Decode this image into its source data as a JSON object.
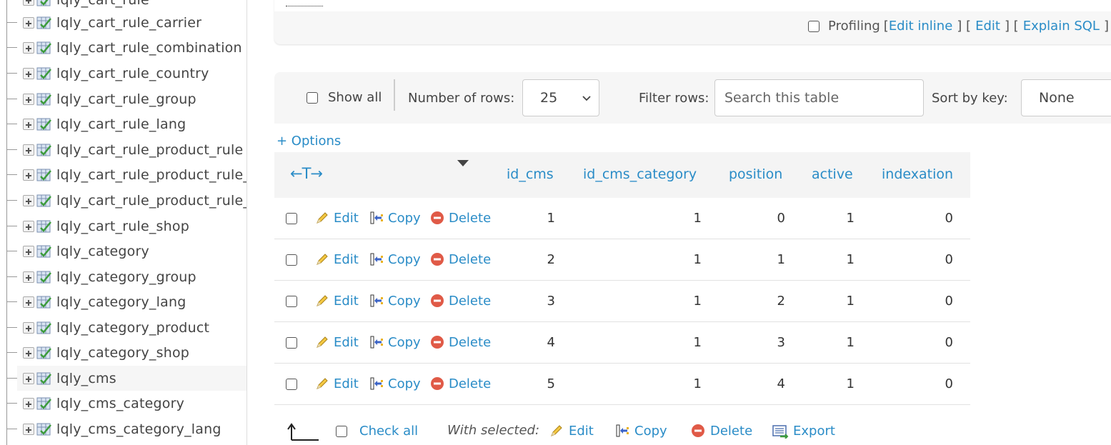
{
  "sidebar": {
    "items": [
      {
        "label": "lqly_cart_rule"
      },
      {
        "label": "lqly_cart_rule_carrier"
      },
      {
        "label": "lqly_cart_rule_combination"
      },
      {
        "label": "lqly_cart_rule_country"
      },
      {
        "label": "lqly_cart_rule_group"
      },
      {
        "label": "lqly_cart_rule_lang"
      },
      {
        "label": "lqly_cart_rule_product_rule"
      },
      {
        "label": "lqly_cart_rule_product_rule_"
      },
      {
        "label": "lqly_cart_rule_product_rule_"
      },
      {
        "label": "lqly_cart_rule_shop"
      },
      {
        "label": "lqly_category"
      },
      {
        "label": "lqly_category_group"
      },
      {
        "label": "lqly_category_lang"
      },
      {
        "label": "lqly_category_product"
      },
      {
        "label": "lqly_category_shop"
      },
      {
        "label": "lqly_cms"
      },
      {
        "label": "lqly_cms_category"
      },
      {
        "label": "lqly_cms_category_lang"
      }
    ],
    "selected_label": "lqly_cms"
  },
  "sql_box": {
    "profiling_label": "Profiling",
    "edit_inline": "Edit inline",
    "edit": "Edit",
    "explain_sql": "Explain SQL",
    "lbr": "[",
    "rbr": "]",
    "sep1": "] [",
    "sep2": "] ["
  },
  "nav": {
    "show_all": "Show all",
    "rows_label": "Number of rows:",
    "rows_value": "25",
    "filter_label": "Filter rows:",
    "filter_placeholder": "Search this table",
    "sort_label": "Sort by key:",
    "sort_value": "None"
  },
  "options_link": "+ Options",
  "table": {
    "arrows": "←T→",
    "columns": [
      "id_cms",
      "id_cms_category",
      "position",
      "active",
      "indexation"
    ],
    "action_labels": {
      "edit": "Edit",
      "copy": "Copy",
      "delete": "Delete"
    },
    "rows": [
      [
        "1",
        "1",
        "0",
        "1",
        "0"
      ],
      [
        "2",
        "1",
        "1",
        "1",
        "0"
      ],
      [
        "3",
        "1",
        "2",
        "1",
        "0"
      ],
      [
        "4",
        "1",
        "3",
        "1",
        "0"
      ],
      [
        "5",
        "1",
        "4",
        "1",
        "0"
      ]
    ]
  },
  "bottom": {
    "check_all": "Check all",
    "with_selected": "With selected:",
    "edit": "Edit",
    "copy": "Copy",
    "delete": "Delete",
    "export": "Export"
  },
  "colors": {
    "link": "#2a8cc7",
    "delete_icon": "#e05a47"
  }
}
